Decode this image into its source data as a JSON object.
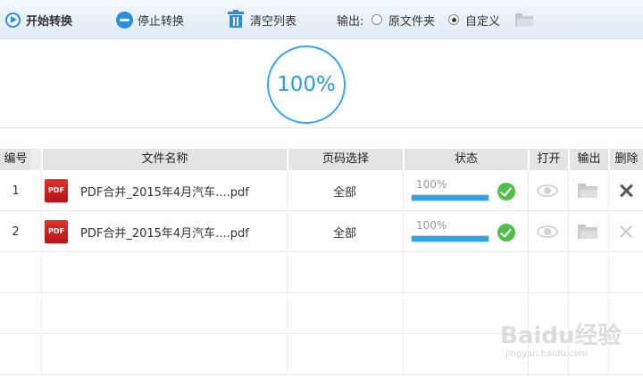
{
  "toolbar": {
    "start_label": "开始转换",
    "stop_label": "停止转换",
    "clear_label": "清空列表",
    "output_label": "输出:",
    "option_original": "原文件夹",
    "option_custom": "自定义",
    "selected_option": "自定义",
    "accent_color": "#2a8ee0"
  },
  "progress": {
    "label": "100%",
    "value": 100
  },
  "table": {
    "headers": {
      "num": "编号",
      "name": "文件名称",
      "pages": "页码选择",
      "status": "状态",
      "open": "打开",
      "output": "输出",
      "delete": "删除"
    },
    "rows": [
      {
        "num": "1",
        "icon": "PDF",
        "name": "PDF合并_2015年4月汽车....pdf",
        "pages": "全部",
        "status": "100%",
        "progress": 100,
        "done": true
      },
      {
        "num": "2",
        "icon": "PDF",
        "name": "PDF合并_2015年4月汽车....pdf",
        "pages": "全部",
        "status": "100%",
        "progress": 100,
        "done": true
      }
    ]
  },
  "watermark": {
    "main": "Baidu经验",
    "sub": "jingyan.baidu.com"
  }
}
